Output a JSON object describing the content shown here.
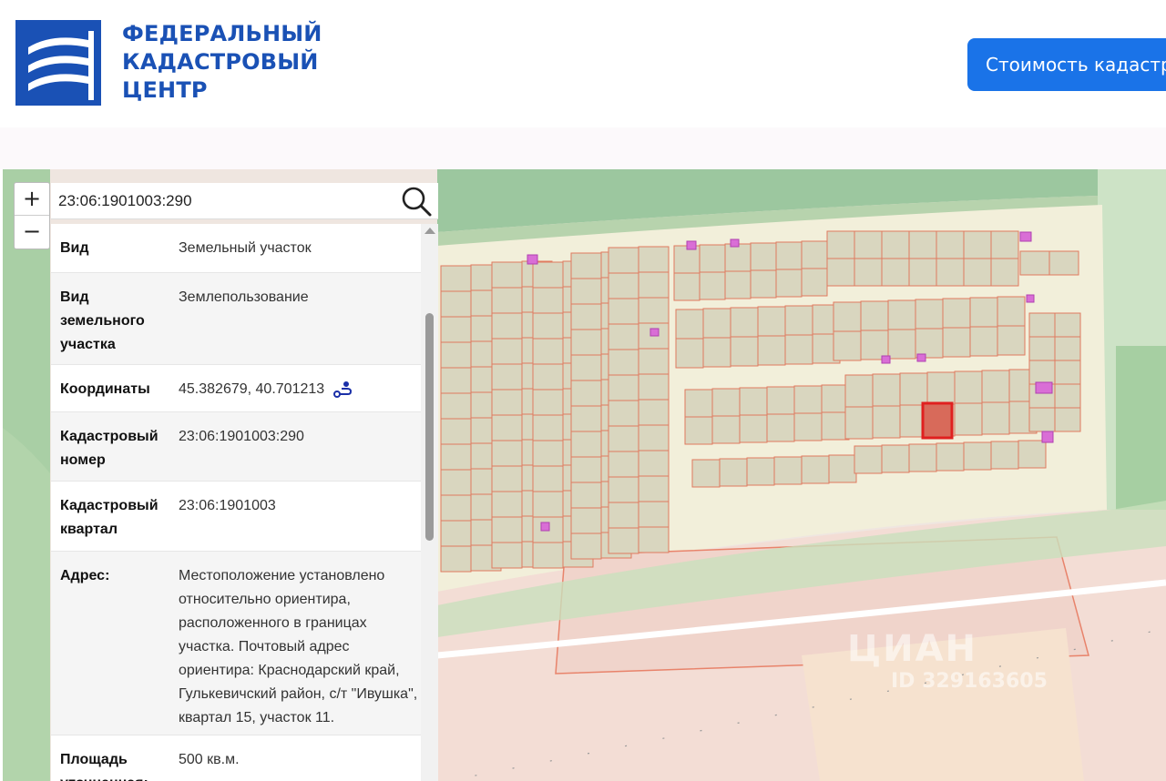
{
  "header": {
    "logo_lines": [
      "ФЕДЕРАЛЬНЫЙ",
      "КАДАСТРОВЫЙ",
      "ЦЕНТР"
    ],
    "cost_button_label": "Стоимость кадастр",
    "brand_color": "#1a51b5",
    "button_color": "#1a73e8"
  },
  "map": {
    "zoom_in": "+",
    "zoom_out": "−",
    "search_value": "23:06:1901003:290",
    "search_icon": "search-icon",
    "watermark": {
      "brand": "ЦИАН",
      "id": "ID 329163605"
    },
    "highlight_color": "#e0201f",
    "parcel_color": "#e07a5f"
  },
  "info": {
    "rows": [
      {
        "label": "Вид",
        "value": "Земельный участок"
      },
      {
        "label": "Вид земельного участка",
        "value": "Землепользование"
      },
      {
        "label": "Координаты",
        "value": "45.382679, 40.701213"
      },
      {
        "label": "Кадастровый номер",
        "value": "23:06:1901003:290"
      },
      {
        "label": "Кадастровый квартал",
        "value": "23:06:1901003"
      },
      {
        "label": "Адрес:",
        "value": "Местоположение установлено относительно ориентира, расположенного в границах участка. Почтовый адрес ориентира: Краснодарский край, Гулькевичский район, с/т \"Ивушка\", квартал 15, участок 11."
      },
      {
        "label": "Площадь уточненная:",
        "value": "500 кв.м."
      }
    ]
  }
}
